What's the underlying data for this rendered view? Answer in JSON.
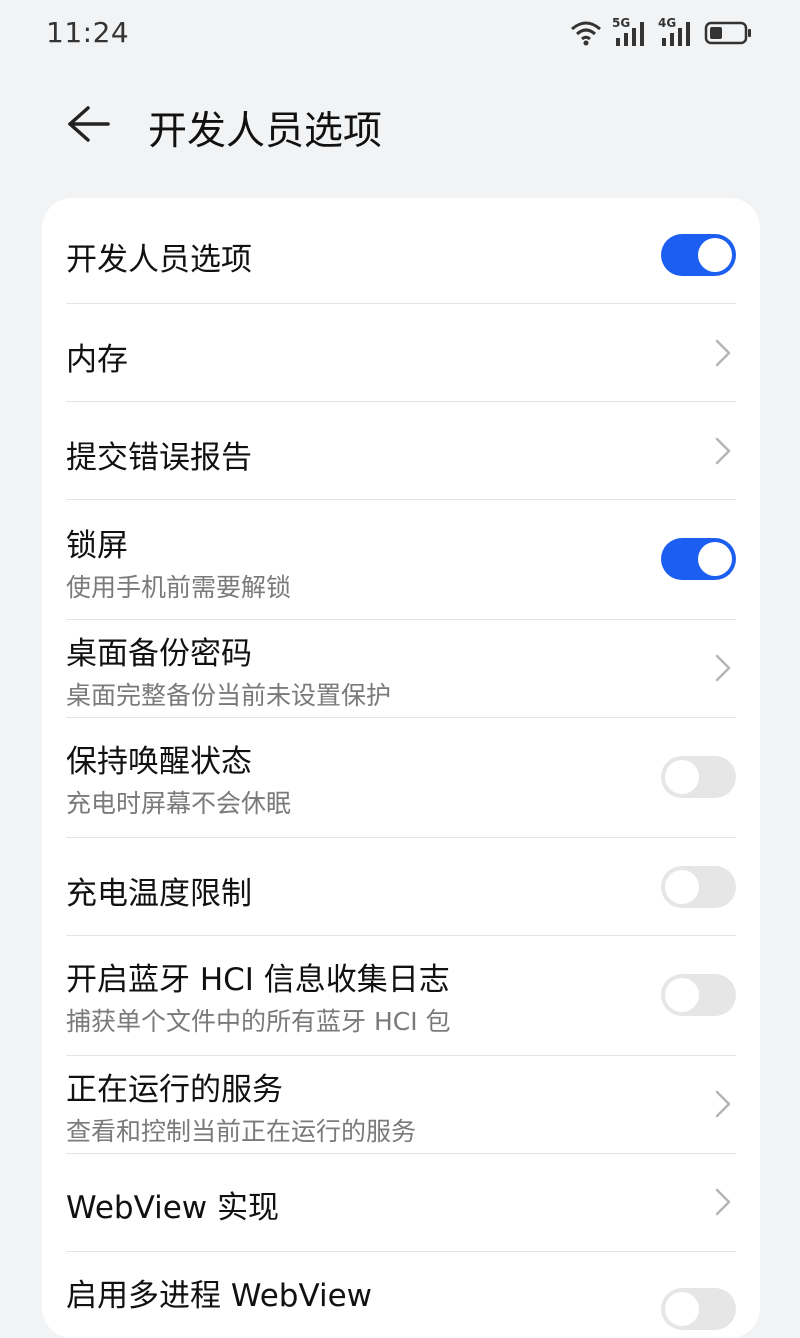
{
  "status_bar": {
    "time": "11:24",
    "network_1": "5G",
    "network_2": "4G",
    "icons": [
      "wifi-icon",
      "signal-5g-icon",
      "signal-4g-icon",
      "battery-icon"
    ]
  },
  "header": {
    "back_icon": "arrow-left-icon",
    "title": "开发人员选项"
  },
  "colors": {
    "accent": "#1b5ef0",
    "background": "#f1f3f5",
    "card": "#ffffff",
    "toggle_off": "#e6e6e6",
    "subtitle": "#7a7a7a"
  },
  "settings": [
    {
      "title": "开发人员选项",
      "subtitle": "",
      "control": "toggle",
      "on": true
    },
    {
      "title": "内存",
      "subtitle": "",
      "control": "chevron"
    },
    {
      "title": "提交错误报告",
      "subtitle": "",
      "control": "chevron"
    },
    {
      "title": "锁屏",
      "subtitle": "使用手机前需要解锁",
      "control": "toggle",
      "on": true
    },
    {
      "title": "桌面备份密码",
      "subtitle": "桌面完整备份当前未设置保护",
      "control": "chevron"
    },
    {
      "title": "保持唤醒状态",
      "subtitle": "充电时屏幕不会休眠",
      "control": "toggle",
      "on": false
    },
    {
      "title": "充电温度限制",
      "subtitle": "",
      "control": "toggle",
      "on": false
    },
    {
      "title": "开启蓝牙 HCI 信息收集日志",
      "subtitle": "捕获单个文件中的所有蓝牙 HCI 包",
      "control": "toggle",
      "on": false
    },
    {
      "title": "正在运行的服务",
      "subtitle": "查看和控制当前正在运行的服务",
      "control": "chevron"
    },
    {
      "title": "WebView 实现",
      "subtitle": "",
      "control": "chevron"
    },
    {
      "title": "启用多进程 WebView",
      "subtitle": "",
      "control": "toggle",
      "on": false
    }
  ]
}
